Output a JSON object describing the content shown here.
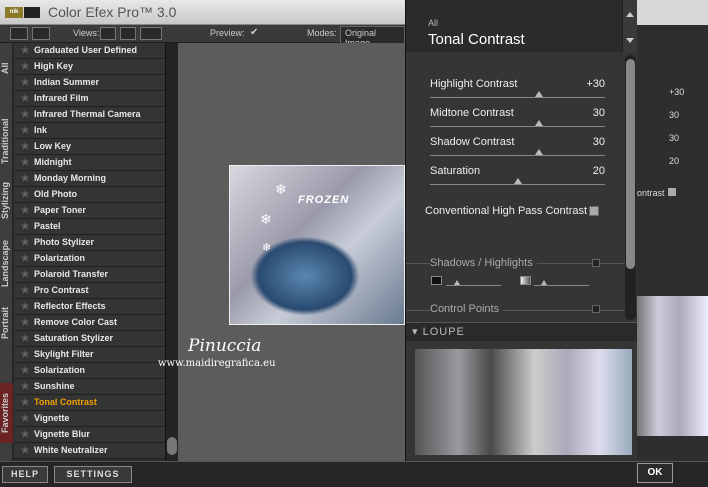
{
  "window": {
    "title": "Color Efex Pro™ 3.0",
    "logo_text": "nik"
  },
  "toolbar": {
    "views_label": "Views:",
    "preview_label": "Preview:",
    "preview_check": "✔",
    "modes_label": "Modes:",
    "mode_value": "Original Image"
  },
  "vertical_tabs": [
    "All",
    "Traditional",
    "Stylizing",
    "Landscape",
    "Portrait",
    "Favorites"
  ],
  "filters": [
    "Graduated User Defined",
    "High Key",
    "Indian Summer",
    "Infrared Film",
    "Infrared Thermal Camera",
    "Ink",
    "Low Key",
    "Midnight",
    "Monday Morning",
    "Old Photo",
    "Paper Toner",
    "Pastel",
    "Photo Stylizer",
    "Polarization",
    "Polaroid Transfer",
    "Pro Contrast",
    "Reflector Effects",
    "Remove Color Cast",
    "Saturation Stylizer",
    "Skylight Filter",
    "Solarization",
    "Sunshine",
    "Tonal Contrast",
    "Vignette",
    "Vignette Blur",
    "White Neutralizer"
  ],
  "selected_filter": "Tonal Contrast",
  "preview_image": {
    "title_text": "FROZEN"
  },
  "watermark": {
    "name": "Pinuccia",
    "url": "www.maidiregrafica.eu"
  },
  "panel": {
    "category": "All",
    "filter_name": "Tonal Contrast",
    "sliders": [
      {
        "label": "Highlight Contrast",
        "value": "+30",
        "position": 0.62
      },
      {
        "label": "Midtone Contrast",
        "value": "30",
        "position": 0.62
      },
      {
        "label": "Shadow Contrast",
        "value": "30",
        "position": 0.62
      },
      {
        "label": "Saturation",
        "value": "20",
        "position": 0.5
      }
    ],
    "conventional_label": "Conventional High Pass Contrast",
    "shadows_highlights": "Shadows / Highlights",
    "control_points": "Control Points",
    "loupe": "LOUPE"
  },
  "right_values": [
    "+30",
    "30",
    "30",
    "20"
  ],
  "right_contrast_label": "ontrast",
  "buttons": {
    "help": "HELP",
    "settings": "SETTINGS",
    "ok": "OK"
  }
}
